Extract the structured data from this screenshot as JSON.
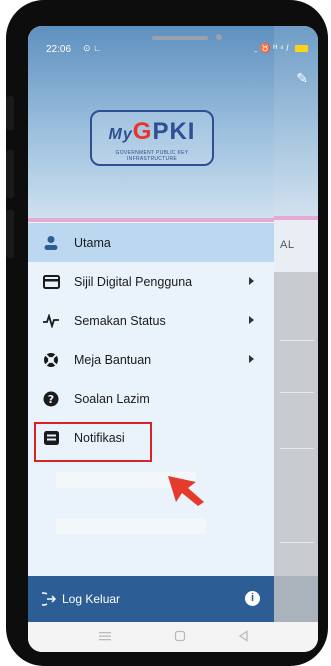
{
  "status_bar": {
    "time": "22:06",
    "left_icons": "⊙ ∟",
    "right_icons": "ˍ ♉ ᴴ ⁴ 𝑙"
  },
  "background": {
    "tab_label": "AL"
  },
  "logo": {
    "prefix": "My",
    "g_letter": "G",
    "rest": "PKI",
    "tagline": "GOVERNMENT PUBLIC KEY INFRASTRUCTURE"
  },
  "menu": {
    "items": [
      {
        "label": "Utama",
        "icon": "person-icon",
        "active": true,
        "has_arrow": false
      },
      {
        "label": "Sijil Digital Pengguna",
        "icon": "card-icon",
        "active": false,
        "has_arrow": true
      },
      {
        "label": "Semakan Status",
        "icon": "pulse-icon",
        "active": false,
        "has_arrow": true
      },
      {
        "label": "Meja Bantuan",
        "icon": "lifebuoy-icon",
        "active": false,
        "has_arrow": true
      },
      {
        "label": "Soalan Lazim",
        "icon": "help-icon",
        "active": false,
        "has_arrow": false
      },
      {
        "label": "Notifikasi",
        "icon": "notification-icon",
        "active": false,
        "has_arrow": false
      }
    ]
  },
  "footer": {
    "logout_label": "Log Keluar",
    "info_icon": "i"
  },
  "colors": {
    "drawer_bg": "#eaf2fb",
    "active_item": "#bcd8f0",
    "footer": "#2d5d95",
    "highlight": "#d42424",
    "brand": "#2f4e93"
  }
}
